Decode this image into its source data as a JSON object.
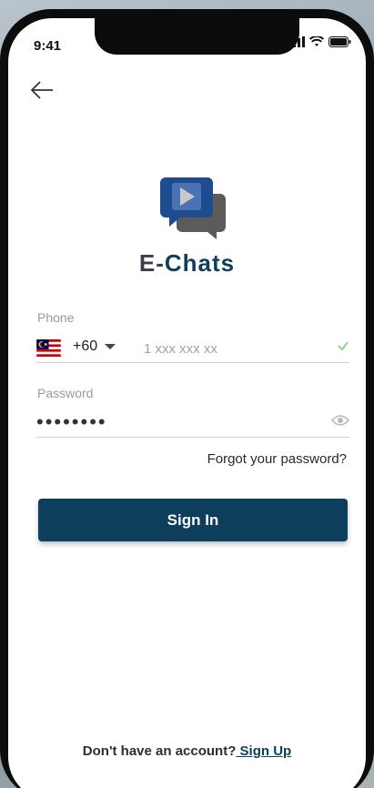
{
  "status_bar": {
    "time": "9:41",
    "icons": [
      "signal-icon",
      "wifi-icon",
      "battery-icon"
    ]
  },
  "header": {
    "back_icon": "arrow-left-icon"
  },
  "brand": {
    "logo_icon": "chat-bubbles-play-icon",
    "name_part1": "E-",
    "name_part2": "Chats",
    "colors": {
      "primary": "#0d3e5c",
      "logo_blue": "#1f4b8f",
      "logo_grey": "#5b5b5b"
    }
  },
  "form": {
    "phone": {
      "label": "Phone",
      "country_flag": "malaysia-flag-icon",
      "country_code": "+60",
      "placeholder": "1 xxx xxx xx",
      "value": "",
      "valid_icon": "check-icon",
      "valid_color": "#7ed67e"
    },
    "password": {
      "label": "Password",
      "value": "••••••••",
      "toggle_icon": "eye-icon"
    },
    "forgot_label": "Forgot your password?",
    "submit_label": "Sign In"
  },
  "footer": {
    "prompt": "Don't have an account?",
    "link_label": " Sign Up"
  }
}
